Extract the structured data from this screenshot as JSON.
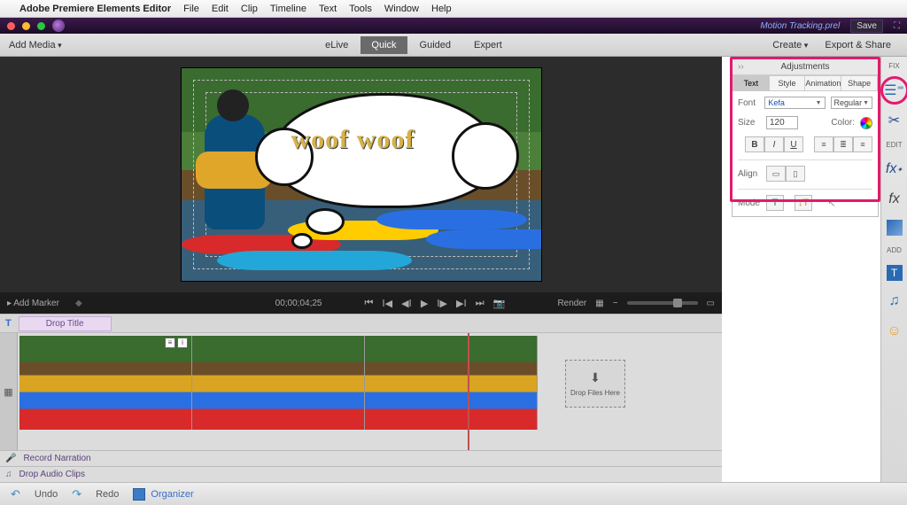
{
  "mac_menu": {
    "apple": "",
    "app": "Adobe Premiere Elements Editor",
    "items": [
      "File",
      "Edit",
      "Clip",
      "Timeline",
      "Text",
      "Tools",
      "Window",
      "Help"
    ]
  },
  "appbar": {
    "project": "Motion Tracking.prel",
    "save": "Save"
  },
  "toolbar": {
    "addmedia": "Add Media",
    "modes": [
      "eLive",
      "Quick",
      "Guided",
      "Expert"
    ],
    "active": "Quick",
    "create": "Create",
    "export": "Export & Share"
  },
  "preview": {
    "text": "woof woof"
  },
  "playbar": {
    "marker": "▸ Add Marker",
    "timecode": "00;00;04;25",
    "render": "Render"
  },
  "droprow": {
    "t": "T",
    "label": "Drop Title"
  },
  "dropzone": {
    "icon": "⬇",
    "label": "Drop Files Here"
  },
  "narration": {
    "rec": "Record Narration",
    "audio": "Drop Audio Clips"
  },
  "bottom": {
    "undo": "Undo",
    "redo": "Redo",
    "organizer": "Organizer"
  },
  "rail": {
    "fix": "FIX",
    "edit": "EDIT",
    "add": "ADD"
  },
  "panel": {
    "title": "Adjustments",
    "tabs": [
      "Text",
      "Style",
      "Animation",
      "Shape"
    ],
    "active": "Text",
    "fontLabel": "Font",
    "fontValue": "Kefa",
    "fontStyle": "Regular",
    "sizeLabel": "Size",
    "sizeValue": "120",
    "colorLabel": "Color:",
    "b": "B",
    "i": "I",
    "u": "U",
    "alignLabel": "Align",
    "modeLabel": "Mode"
  }
}
